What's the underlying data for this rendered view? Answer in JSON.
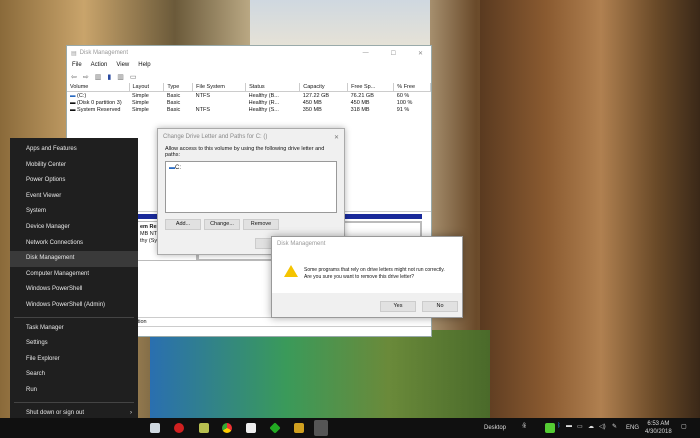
{
  "disk_management": {
    "title": "Disk Management",
    "menu": [
      "File",
      "Action",
      "View",
      "Help"
    ],
    "columns": [
      "Volume",
      "Layout",
      "Type",
      "File System",
      "Status",
      "Capacity",
      "Free Sp...",
      "% Free"
    ],
    "rows": [
      [
        "(C:)",
        "Simple",
        "Basic",
        "NTFS",
        "Healthy (B...",
        "127.22 GB",
        "76.21 GB",
        "60 %"
      ],
      [
        "(Disk 0 partition 3)",
        "Simple",
        "Basic",
        "",
        "Healthy (R...",
        "450 MB",
        "450 MB",
        "100 %"
      ],
      [
        "System Reserved",
        "Simple",
        "Basic",
        "NTFS",
        "Healthy (S...",
        "350 MB",
        "318 MB",
        "91 %"
      ]
    ],
    "lower_fragments": {
      "name": "em Rese",
      "fs": "MB NTF",
      "status": "thy (Sys",
      "partition": "partition"
    }
  },
  "change_dialog": {
    "title": "Change Drive Letter and Paths for C: ()",
    "instruction": "Allow access to this volume by using the following drive letter and paths:",
    "paths": [
      "C:"
    ],
    "add": "Add...",
    "change": "Change...",
    "remove": "Remove",
    "ok_fragment": "O"
  },
  "confirm_dialog": {
    "title": "Disk Management",
    "line1": "Some programs that rely on drive letters might not run correctly.",
    "line2": "Are you sure you want to remove this drive letter?",
    "yes": "Yes",
    "no": "No"
  },
  "winx_menu": {
    "group1": [
      "Apps and Features",
      "Mobility Center",
      "Power Options",
      "Event Viewer",
      "System",
      "Device Manager",
      "Network Connections",
      "Disk Management",
      "Computer Management",
      "Windows PowerShell",
      "Windows PowerShell (Admin)"
    ],
    "group2": [
      "Task Manager",
      "Settings",
      "File Explorer",
      "Search",
      "Run"
    ],
    "group3": [
      "Shut down or sign out",
      "Desktop"
    ],
    "selected": "Disk Management"
  },
  "taskbar": {
    "desktop_label": "Desktop",
    "language": "ENG",
    "time": "6:53 AM",
    "date": "4/30/2018"
  }
}
